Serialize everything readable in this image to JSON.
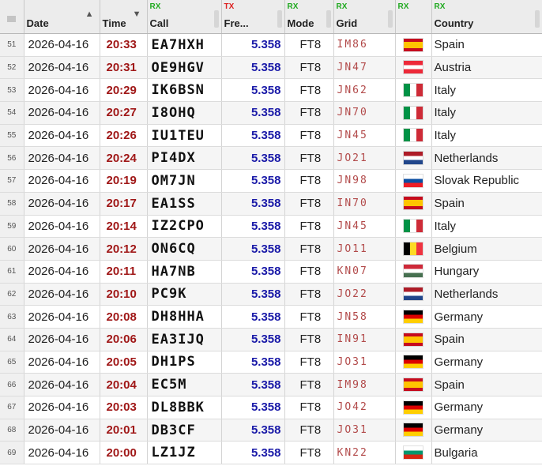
{
  "headers": {
    "date": {
      "label": "Date"
    },
    "time": {
      "label": "Time"
    },
    "call": {
      "tag": "RX",
      "label": "Call"
    },
    "freq": {
      "tag": "TX",
      "label": "Fre..."
    },
    "mode": {
      "tag": "RX",
      "label": "Mode"
    },
    "grid": {
      "tag": "RX",
      "label": "Grid"
    },
    "flag": {
      "tag": "RX"
    },
    "country": {
      "tag": "RX",
      "label": "Country"
    }
  },
  "flags": {
    "Spain": "linear-gradient(to bottom,#c60b1e 0 25%,#ffc400 25% 75%,#c60b1e 75% 100%)",
    "Austria": "linear-gradient(to bottom,#ed2939 0 33.3%,#ffffff 33.3% 66.6%,#ed2939 66.6% 100%)",
    "Italy": "linear-gradient(to right,#009246 0 33.3%,#ffffff 33.3% 66.6%,#ce2b37 66.6% 100%)",
    "Netherlands": "linear-gradient(to bottom,#ae1c28 0 33.3%,#ffffff 33.3% 66.6%,#21468b 66.6% 100%)",
    "Slovak Republic": "linear-gradient(to bottom,#ffffff 0 33.3%,#0b4ea2 33.3% 66.6%,#ee1c25 66.6% 100%)",
    "Belgium": "linear-gradient(to right,#000000 0 33.3%,#fdda24 33.3% 66.6%,#ef3340 66.6% 100%)",
    "Hungary": "linear-gradient(to bottom,#ce2939 0 33.3%,#ffffff 33.3% 66.6%,#477050 66.6% 100%)",
    "Germany": "linear-gradient(to bottom,#000000 0 33.3%,#dd0000 33.3% 66.6%,#ffce00 66.6% 100%)",
    "Bulgaria": "linear-gradient(to bottom,#ffffff 0 33.3%,#00966e 33.3% 66.6%,#d62612 66.6% 100%)"
  },
  "rows": [
    {
      "idx": "51",
      "date": "2026-04-16",
      "time": "20:33",
      "call": "EA7HXH",
      "freq": "5.358",
      "mode": "FT8",
      "grid": "IM86",
      "country": "Spain"
    },
    {
      "idx": "52",
      "date": "2026-04-16",
      "time": "20:31",
      "call": "OE9HGV",
      "freq": "5.358",
      "mode": "FT8",
      "grid": "JN47",
      "country": "Austria"
    },
    {
      "idx": "53",
      "date": "2026-04-16",
      "time": "20:29",
      "call": "IK6BSN",
      "freq": "5.358",
      "mode": "FT8",
      "grid": "JN62",
      "country": "Italy"
    },
    {
      "idx": "54",
      "date": "2026-04-16",
      "time": "20:27",
      "call": "I8OHQ",
      "freq": "5.358",
      "mode": "FT8",
      "grid": "JN70",
      "country": "Italy"
    },
    {
      "idx": "55",
      "date": "2026-04-16",
      "time": "20:26",
      "call": "IU1TEU",
      "freq": "5.358",
      "mode": "FT8",
      "grid": "JN45",
      "country": "Italy"
    },
    {
      "idx": "56",
      "date": "2026-04-16",
      "time": "20:24",
      "call": "PI4DX",
      "freq": "5.358",
      "mode": "FT8",
      "grid": "JO21",
      "country": "Netherlands"
    },
    {
      "idx": "57",
      "date": "2026-04-16",
      "time": "20:19",
      "call": "OM7JN",
      "freq": "5.358",
      "mode": "FT8",
      "grid": "JN98",
      "country": "Slovak Republic"
    },
    {
      "idx": "58",
      "date": "2026-04-16",
      "time": "20:17",
      "call": "EA1SS",
      "freq": "5.358",
      "mode": "FT8",
      "grid": "IN70",
      "country": "Spain"
    },
    {
      "idx": "59",
      "date": "2026-04-16",
      "time": "20:14",
      "call": "IZ2CPO",
      "freq": "5.358",
      "mode": "FT8",
      "grid": "JN45",
      "country": "Italy"
    },
    {
      "idx": "60",
      "date": "2026-04-16",
      "time": "20:12",
      "call": "ON6CQ",
      "freq": "5.358",
      "mode": "FT8",
      "grid": "JO11",
      "country": "Belgium"
    },
    {
      "idx": "61",
      "date": "2026-04-16",
      "time": "20:11",
      "call": "HA7NB",
      "freq": "5.358",
      "mode": "FT8",
      "grid": "KN07",
      "country": "Hungary"
    },
    {
      "idx": "62",
      "date": "2026-04-16",
      "time": "20:10",
      "call": "PC9K",
      "freq": "5.358",
      "mode": "FT8",
      "grid": "JO22",
      "country": "Netherlands"
    },
    {
      "idx": "63",
      "date": "2026-04-16",
      "time": "20:08",
      "call": "DH8HHA",
      "freq": "5.358",
      "mode": "FT8",
      "grid": "JN58",
      "country": "Germany"
    },
    {
      "idx": "64",
      "date": "2026-04-16",
      "time": "20:06",
      "call": "EA3IJQ",
      "freq": "5.358",
      "mode": "FT8",
      "grid": "IN91",
      "country": "Spain"
    },
    {
      "idx": "65",
      "date": "2026-04-16",
      "time": "20:05",
      "call": "DH1PS",
      "freq": "5.358",
      "mode": "FT8",
      "grid": "JO31",
      "country": "Germany"
    },
    {
      "idx": "66",
      "date": "2026-04-16",
      "time": "20:04",
      "call": "EC5M",
      "freq": "5.358",
      "mode": "FT8",
      "grid": "IM98",
      "country": "Spain"
    },
    {
      "idx": "67",
      "date": "2026-04-16",
      "time": "20:03",
      "call": "DL8BBK",
      "freq": "5.358",
      "mode": "FT8",
      "grid": "JO42",
      "country": "Germany"
    },
    {
      "idx": "68",
      "date": "2026-04-16",
      "time": "20:01",
      "call": "DB3CF",
      "freq": "5.358",
      "mode": "FT8",
      "grid": "JO31",
      "country": "Germany"
    },
    {
      "idx": "69",
      "date": "2026-04-16",
      "time": "20:00",
      "call": "LZ1JZ",
      "freq": "5.358",
      "mode": "FT8",
      "grid": "KN22",
      "country": "Bulgaria"
    }
  ]
}
